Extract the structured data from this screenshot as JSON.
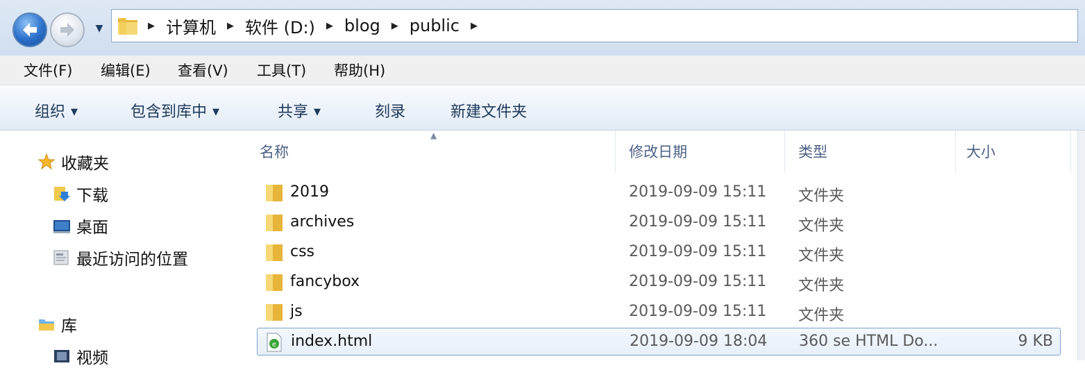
{
  "address_bar": {
    "crumbs": [
      "计算机",
      "软件 (D:)",
      "blog",
      "public"
    ]
  },
  "menu": [
    "文件(F)",
    "编辑(E)",
    "查看(V)",
    "工具(T)",
    "帮助(H)"
  ],
  "commands": {
    "organize": "组织",
    "include_in_library": "包含到库中",
    "share": "共享",
    "burn": "刻录",
    "new_folder": "新建文件夹"
  },
  "nav_pane": {
    "favorites": "收藏夹",
    "downloads": "下载",
    "desktop": "桌面",
    "recent": "最近访问的位置",
    "libraries": "库",
    "videos": "视频"
  },
  "columns": {
    "name": "名称",
    "date_modified": "修改日期",
    "type": "类型",
    "size": "大小"
  },
  "files": [
    {
      "name": "2019",
      "date": "2019-09-09 15:11",
      "type": "文件夹",
      "size": "",
      "icon": "folder-icon"
    },
    {
      "name": "archives",
      "date": "2019-09-09 15:11",
      "type": "文件夹",
      "size": "",
      "icon": "folder-icon"
    },
    {
      "name": "css",
      "date": "2019-09-09 15:11",
      "type": "文件夹",
      "size": "",
      "icon": "folder-icon"
    },
    {
      "name": "fancybox",
      "date": "2019-09-09 15:11",
      "type": "文件夹",
      "size": "",
      "icon": "folder-icon"
    },
    {
      "name": "js",
      "date": "2019-09-09 15:11",
      "type": "文件夹",
      "size": "",
      "icon": "folder-icon"
    },
    {
      "name": "index.html",
      "date": "2019-09-09 18:04",
      "type": "360 se HTML Do...",
      "size": "9 KB",
      "icon": "html-file-icon",
      "selected": true
    }
  ],
  "colors": {
    "addr_bg": "#dfe9f5",
    "cmd_text": "#1e395b",
    "header_text": "#4d6185",
    "selection_border": "#7da2ce",
    "folder_yellow": "#f1c84b"
  }
}
